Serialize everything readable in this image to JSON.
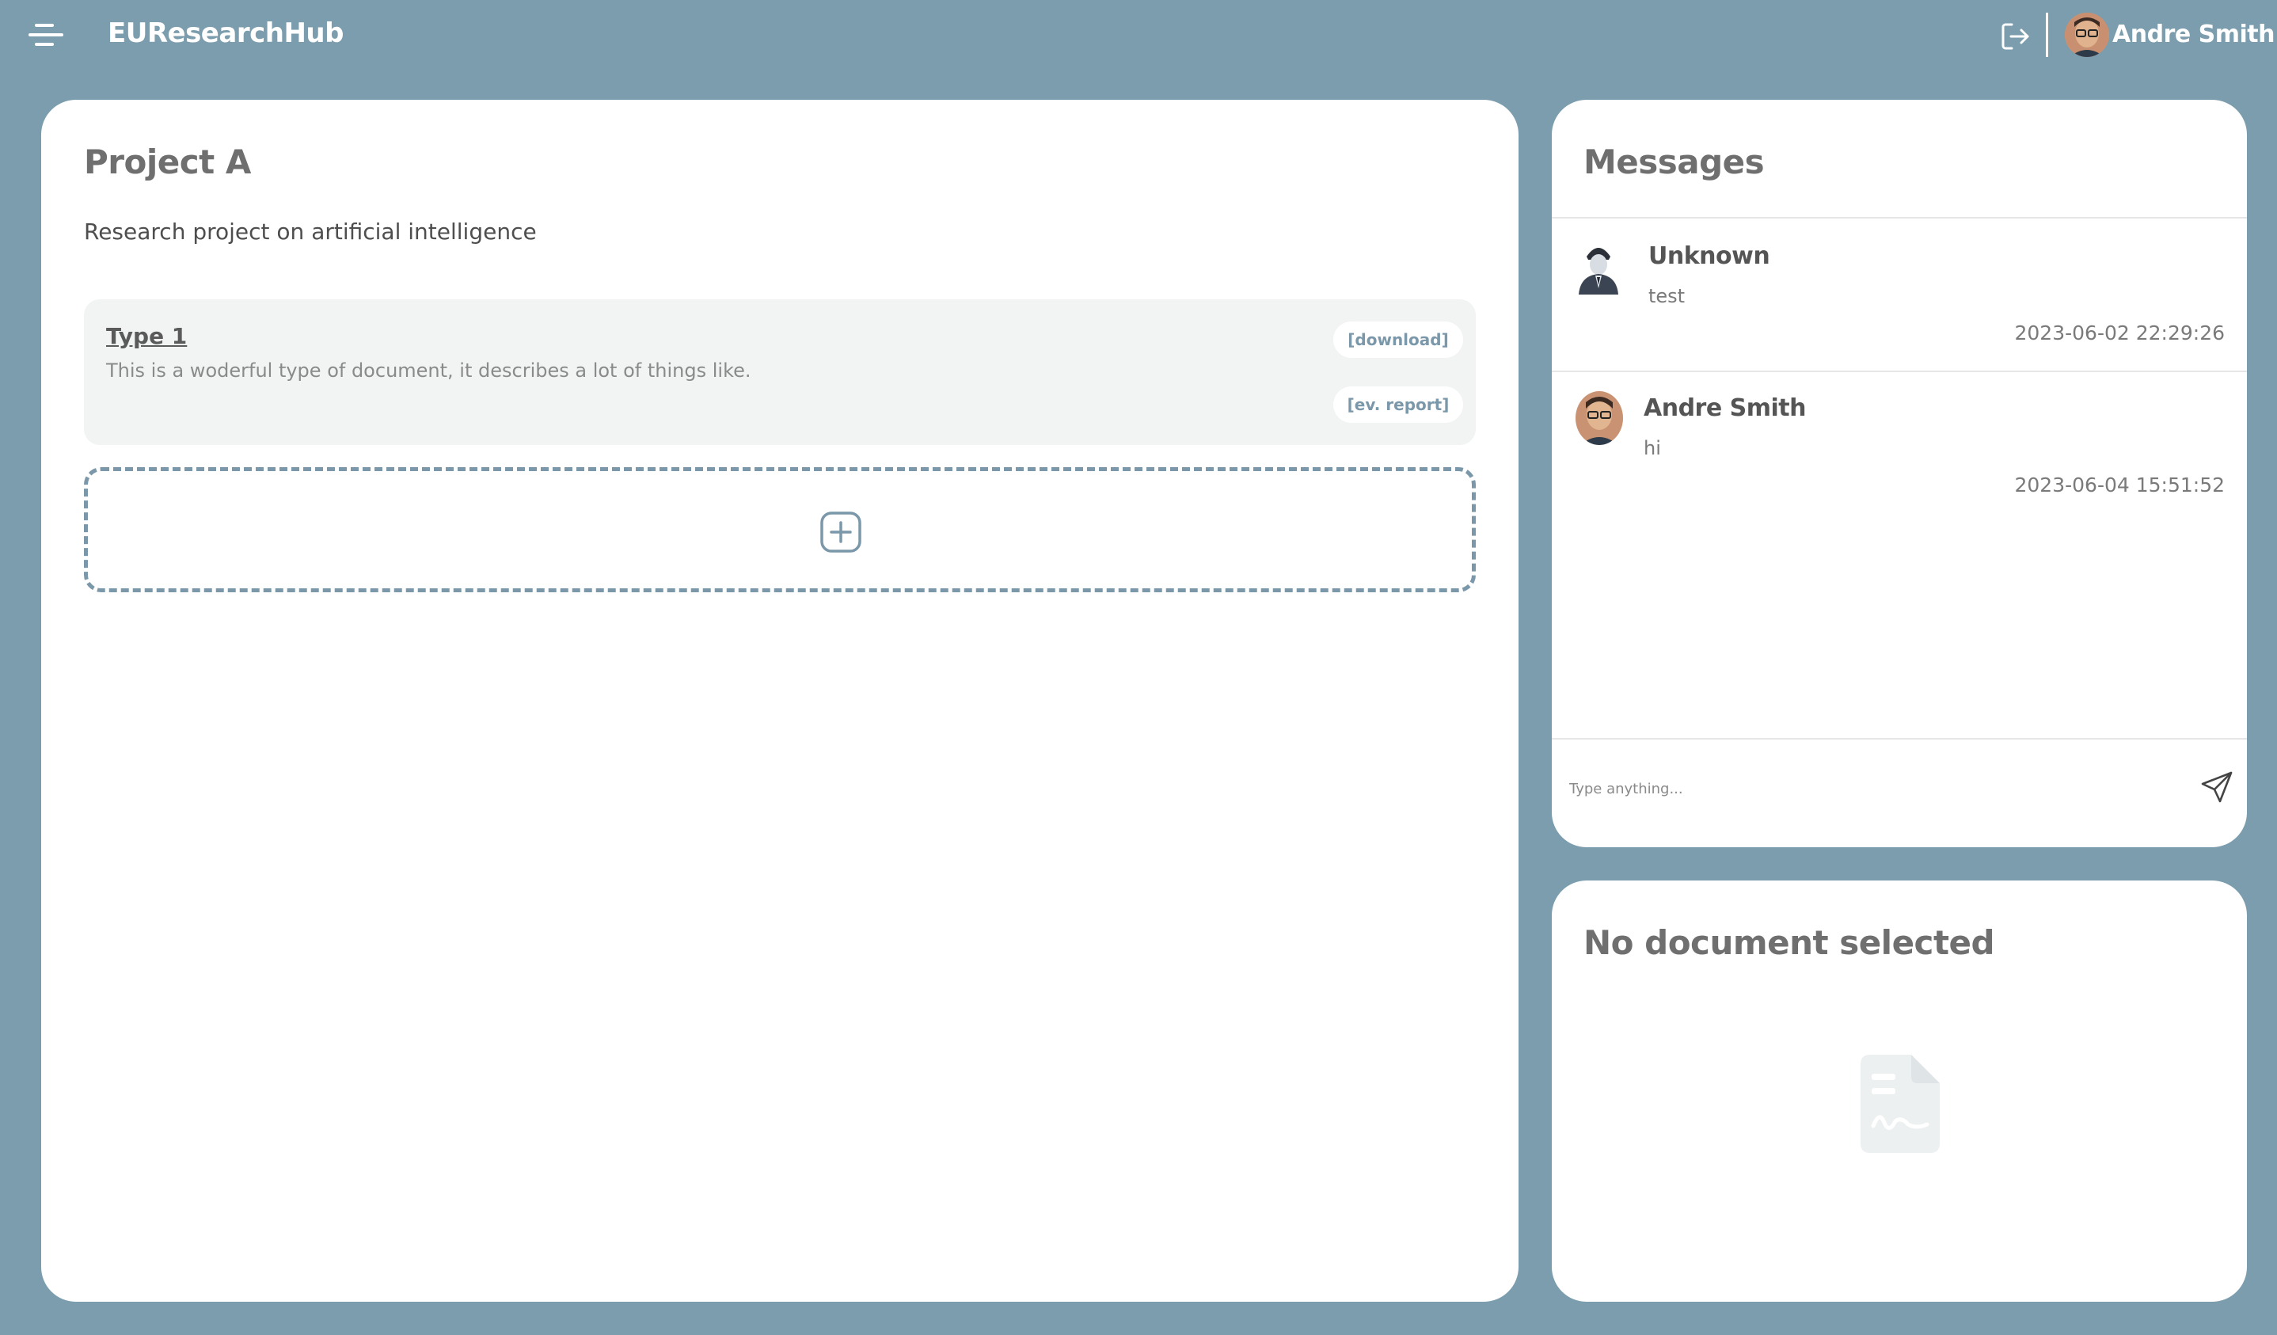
{
  "header": {
    "app_title": "EUResearchHub",
    "user_name": "Andre Smith",
    "menu_icon": "hamburger-menu-icon",
    "logout_icon": "logout-icon"
  },
  "project": {
    "title": "Project A",
    "description": "Research project on artificial intelligence",
    "documents": [
      {
        "type": "Type 1",
        "description": "This is a woderful type of document, it describes a lot of things like.",
        "download_label": "[download]",
        "report_label": "[ev. report]"
      }
    ],
    "add_icon": "plus-square-icon"
  },
  "messages": {
    "title": "Messages",
    "items": [
      {
        "sender": "Unknown",
        "text": "test",
        "timestamp": "2023-06-02 22:29:26"
      },
      {
        "sender": "Andre Smith",
        "text": "hi",
        "timestamp": "2023-06-04 15:51:52"
      }
    ],
    "input_placeholder": "Type anything...",
    "send_icon": "send-icon"
  },
  "document_viewer": {
    "title": "No document selected",
    "placeholder_icon": "document-icon"
  },
  "colors": {
    "background": "#7b9dad",
    "panel": "#ffffff",
    "accent": "#7b98aa",
    "card": "#f2f4f4"
  }
}
